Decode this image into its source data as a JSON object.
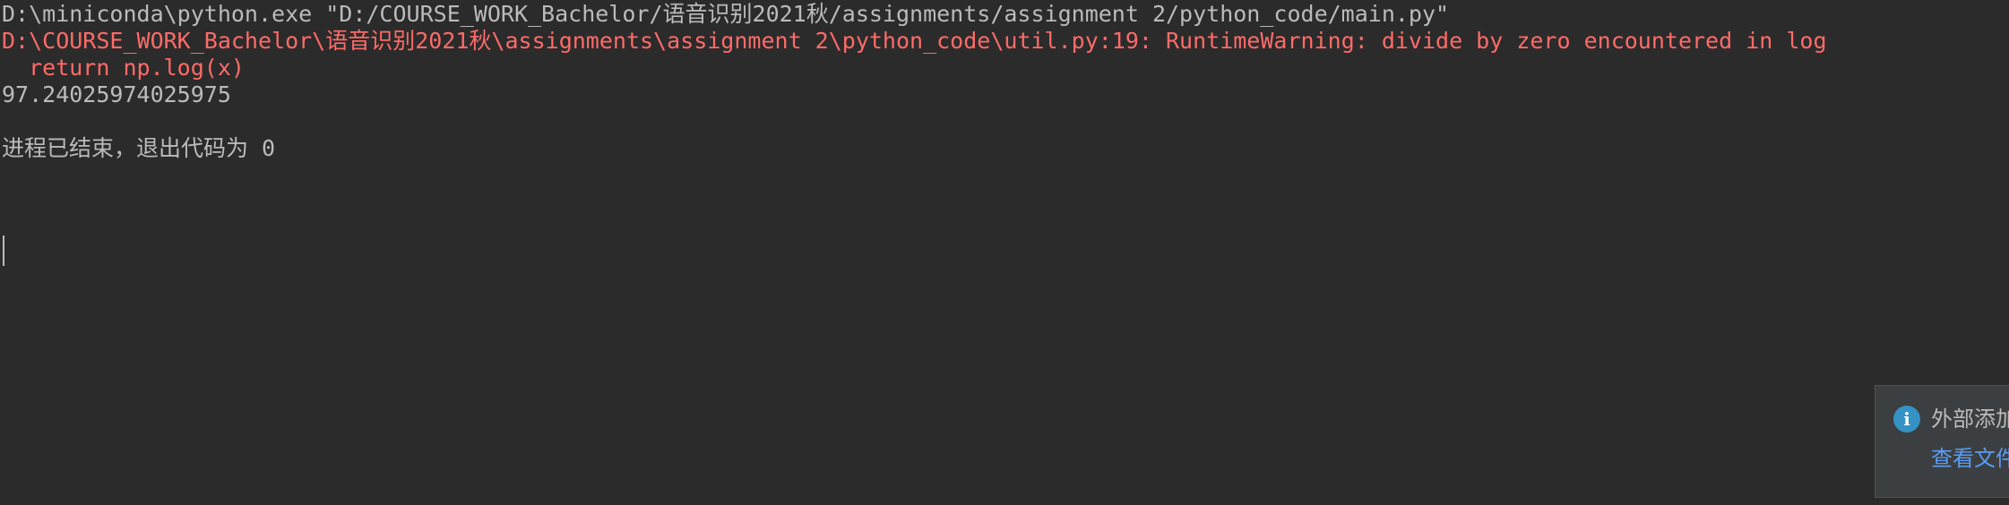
{
  "console": {
    "lines": [
      {
        "text": "D:\\miniconda\\python.exe \"D:/COURSE_WORK_Bachelor/语音识别2021秋/assignments/assignment 2/python_code/main.py\"",
        "kind": "command"
      },
      {
        "text": "D:\\COURSE_WORK_Bachelor\\语音识别2021秋\\assignments\\assignment 2\\python_code\\util.py:19: RuntimeWarning: divide by zero encountered in log",
        "kind": "stderr"
      },
      {
        "text": "  return np.log(x)",
        "kind": "stderr"
      },
      {
        "text": "97.24025974025975",
        "kind": "stdout"
      },
      {
        "text": "",
        "kind": "blank"
      },
      {
        "text": "进程已结束，退出代码为 0",
        "kind": "status"
      }
    ]
  },
  "notification": {
    "icon": "info-icon",
    "icon_glyph": "i",
    "title": "外部添加",
    "link": "查看文件",
    "colors": {
      "icon": "#3592c4",
      "link": "#589df6"
    }
  },
  "colors": {
    "background": "#2b2b2b",
    "text": "#bbbbbb",
    "error": "#ff6b68"
  }
}
